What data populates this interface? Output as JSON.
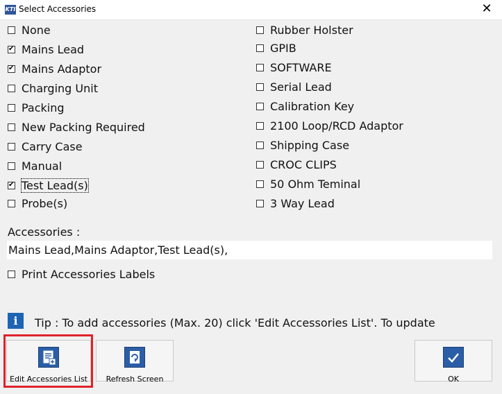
{
  "window": {
    "app_icon_text": "KTI",
    "title": "Select Accessories",
    "close_glyph": "✕"
  },
  "left_options": [
    {
      "label": "None",
      "checked": false
    },
    {
      "label": "Mains Lead",
      "checked": true
    },
    {
      "label": "Mains Adaptor",
      "checked": true
    },
    {
      "label": "Charging Unit",
      "checked": false
    },
    {
      "label": "Packing",
      "checked": false
    },
    {
      "label": "New Packing Required",
      "checked": false
    },
    {
      "label": "Carry Case",
      "checked": false
    },
    {
      "label": "Manual",
      "checked": false
    },
    {
      "label": "Test Lead(s)",
      "checked": true
    },
    {
      "label": "Probe(s)",
      "checked": false
    }
  ],
  "right_options": [
    {
      "label": "Rubber Holster",
      "checked": false
    },
    {
      "label": "GPIB",
      "checked": false
    },
    {
      "label": "SOFTWARE",
      "checked": false
    },
    {
      "label": "Serial Lead",
      "checked": false
    },
    {
      "label": "Calibration Key",
      "checked": false
    },
    {
      "label": "2100 Loop/RCD Adaptor",
      "checked": false
    },
    {
      "label": "Shipping Case",
      "checked": false
    },
    {
      "label": "CROC CLIPS",
      "checked": false
    },
    {
      "label": "50 Ohm Teminal",
      "checked": false
    },
    {
      "label": "3 Way Lead",
      "checked": false
    }
  ],
  "accessories": {
    "caption": "Accessories :",
    "value": "Mains Lead,Mains Adaptor,Test Lead(s),"
  },
  "print_labels": {
    "label": "Print Accessories Labels",
    "checked": false
  },
  "tip": {
    "icon_text": "i",
    "text": "Tip : To add accessories (Max. 20) click 'Edit Accessories List'. To update"
  },
  "buttons": {
    "edit": {
      "label": "Edit Accessories List"
    },
    "refresh": {
      "label": "Refresh Screen"
    },
    "ok": {
      "label": "OK"
    }
  },
  "colors": {
    "highlight_border": "#e0212b",
    "icon_blue": "#2b5ea7"
  }
}
